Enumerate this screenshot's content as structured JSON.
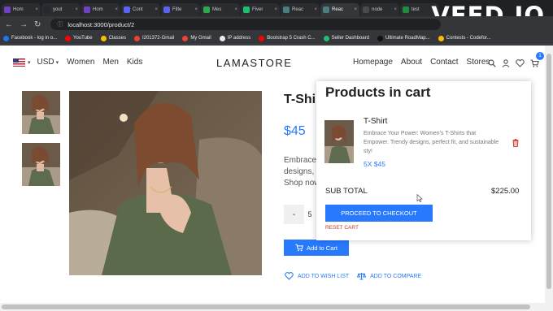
{
  "browser": {
    "tabs": [
      {
        "label": "Hom",
        "color": "#6f42c1"
      },
      {
        "label": "yout",
        "color": "#24292e"
      },
      {
        "label": "Hom",
        "color": "#6f42c1"
      },
      {
        "label": "Cont",
        "color": "#5865f2"
      },
      {
        "label": "Filte",
        "color": "#5865f2"
      },
      {
        "label": "Mes",
        "color": "#2fa84f"
      },
      {
        "label": "Fiver",
        "color": "#1dbf73"
      },
      {
        "label": "Reac",
        "color": "#4a7f7f"
      },
      {
        "label": "Reac",
        "color": "#4a7f7f",
        "active": true
      },
      {
        "label": "node",
        "color": "#4a4a4a"
      },
      {
        "label": "test",
        "color": "#1e8e3e"
      }
    ],
    "url": "localhost:3000/product/2",
    "bookmarks": [
      {
        "label": "Facebook - log in o...",
        "color": "#1877f2"
      },
      {
        "label": "YouTube",
        "color": "#ff0000"
      },
      {
        "label": "Classes",
        "color": "#fbbc04"
      },
      {
        "label": "I201372-Gmail",
        "color": "#ea4335"
      },
      {
        "label": "My Gmail",
        "color": "#ea4335"
      },
      {
        "label": "IP address",
        "color": "#e8eaed"
      },
      {
        "label": "Bootstrap 5 Crash C...",
        "color": "#ff0000"
      },
      {
        "label": "Seller Dashboard",
        "color": "#1dbf73"
      },
      {
        "label": "Ultimate RoadMap...",
        "color": "#111111"
      },
      {
        "label": "Contests - Codefor...",
        "color": "#fbbc04"
      }
    ]
  },
  "watermark": "VEED.IO",
  "navbar": {
    "currency": "USD",
    "left_links": [
      "Women",
      "Men",
      "Kids"
    ],
    "logo": "LAMASTORE",
    "right_links": [
      "Homepage",
      "About",
      "Contact",
      "Stores"
    ],
    "cart_count": "1"
  },
  "product": {
    "title": "T-Shi",
    "price": "$45",
    "description_lines": [
      "Embrace",
      "designs,",
      "Shop now"
    ],
    "qty_minus": "-",
    "quantity": "5",
    "add_to_cart": "Add to Cart",
    "wishlist": "ADD TO WISH LIST",
    "compare": "ADD TO COMPARE"
  },
  "cart": {
    "title": "Products in cart",
    "item": {
      "name": "T-Shirt",
      "description": "Embrace Your Power: Women's T-Shirts that Empower. Trendy designs, perfect fit, and sustainable sty!",
      "qty_price": "5X $45"
    },
    "subtotal_label": "SUB TOTAL",
    "subtotal_value": "$225.00",
    "checkout": "PROCEED TO CHECKOUT",
    "reset": "RESET CART"
  }
}
